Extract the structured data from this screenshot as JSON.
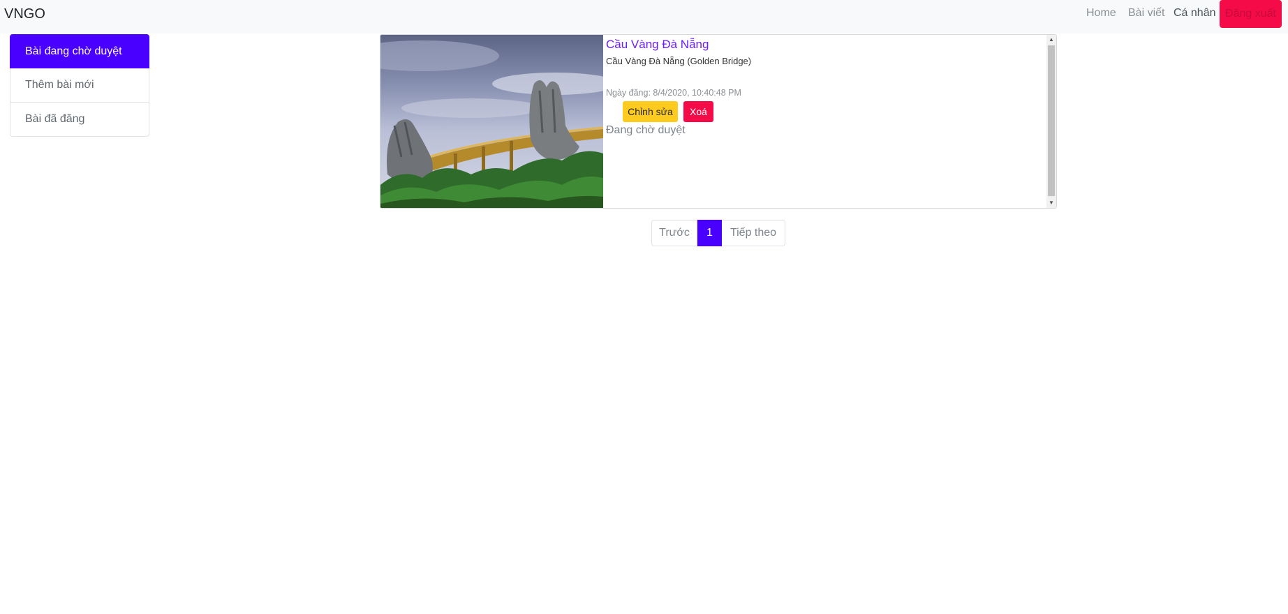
{
  "navbar": {
    "brand": "VNGO",
    "links": [
      "Home",
      "Bài viết",
      "Cá nhân"
    ],
    "logout": "Đăng xuất"
  },
  "sidebar": {
    "items": [
      {
        "label": "Bài đang chờ duyệt",
        "active": true
      },
      {
        "label": "Thêm bài mới",
        "active": false
      },
      {
        "label": "Bài đã đăng",
        "active": false
      }
    ]
  },
  "post": {
    "title": "Cầu Vàng Đà Nẵng",
    "subtitle": "Cầu Vàng Đà Nẵng (Golden Bridge)",
    "date": "Ngày đăng: 8/4/2020, 10:40:48 PM",
    "edit_label": "Chỉnh sửa",
    "delete_label": "Xoá",
    "status": "Đang chờ duyệt",
    "image": "golden-bridge-hands-photo"
  },
  "pagination": {
    "prev": "Trước",
    "current": "1",
    "next": "Tiếp theo"
  },
  "colors": {
    "primary": "#4a00ff",
    "danger": "#f40b47",
    "warning": "#ffcb1f",
    "navbar_bg": "#f8f9fa"
  }
}
